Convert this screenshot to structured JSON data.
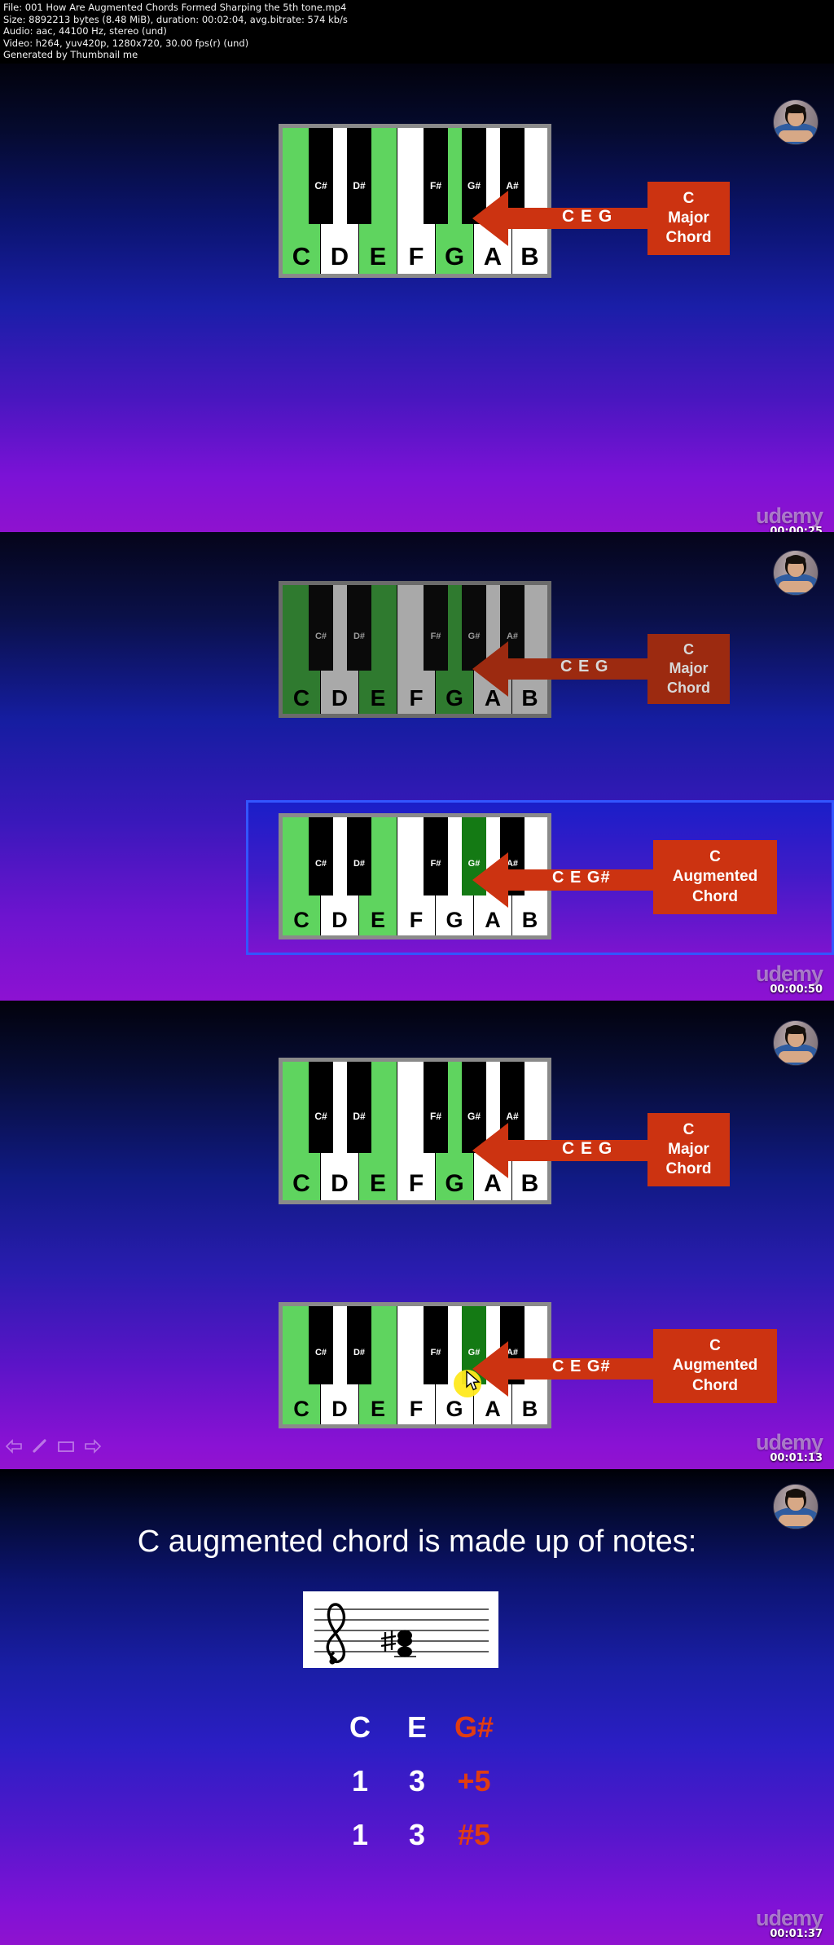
{
  "meta": {
    "lines": [
      "File: 001 How Are Augmented Chords Formed Sharping the 5th tone.mp4",
      "Size: 8892213 bytes (8.48 MiB), duration: 00:02:04, avg.bitrate: 574 kb/s",
      "Audio: aac, 44100 Hz, stereo (und)",
      "Video: h264, yuv420p, 1280x720, 30.00 fps(r) (und)",
      "Generated by Thumbnail me"
    ]
  },
  "watermark": {
    "label": "udemy"
  },
  "panels": [
    {
      "id": "panel-1",
      "timestamp": "00:00:25",
      "keyboard": {
        "white_keys": [
          {
            "label": "C",
            "highlighted": true
          },
          {
            "label": "D",
            "highlighted": false
          },
          {
            "label": "E",
            "highlighted": true
          },
          {
            "label": "F",
            "highlighted": false
          },
          {
            "label": "G",
            "highlighted": true
          },
          {
            "label": "A",
            "highlighted": false
          },
          {
            "label": "B",
            "highlighted": false
          }
        ],
        "black_keys": [
          {
            "label": "C#",
            "highlighted": false
          },
          {
            "label": "D#",
            "highlighted": false
          },
          {
            "label": "F#",
            "highlighted": false
          },
          {
            "label": "G#",
            "highlighted": false
          },
          {
            "label": "A#",
            "highlighted": false
          }
        ]
      },
      "arrow_label": "C E G",
      "chord_box": [
        "C",
        "Major",
        "Chord"
      ]
    },
    {
      "id": "panel-2a",
      "timestamp": "00:00:50",
      "keyboard": {
        "white_keys": [
          {
            "label": "C",
            "highlighted": true
          },
          {
            "label": "D",
            "highlighted": false
          },
          {
            "label": "E",
            "highlighted": true
          },
          {
            "label": "F",
            "highlighted": false
          },
          {
            "label": "G",
            "highlighted": true
          },
          {
            "label": "A",
            "highlighted": false
          },
          {
            "label": "B",
            "highlighted": false
          }
        ],
        "black_keys": [
          {
            "label": "C#",
            "highlighted": false
          },
          {
            "label": "D#",
            "highlighted": false
          },
          {
            "label": "F#",
            "highlighted": false
          },
          {
            "label": "G#",
            "highlighted": false
          },
          {
            "label": "A#",
            "highlighted": false
          }
        ]
      },
      "arrow_label": "C E G",
      "chord_box": [
        "C",
        "Major",
        "Chord"
      ]
    },
    {
      "id": "panel-2b",
      "keyboard": {
        "white_keys": [
          {
            "label": "C",
            "highlighted": true
          },
          {
            "label": "D",
            "highlighted": false
          },
          {
            "label": "E",
            "highlighted": true
          },
          {
            "label": "F",
            "highlighted": false
          },
          {
            "label": "G",
            "highlighted": false
          },
          {
            "label": "A",
            "highlighted": false
          },
          {
            "label": "B",
            "highlighted": false
          }
        ],
        "black_keys": [
          {
            "label": "C#",
            "highlighted": false
          },
          {
            "label": "D#",
            "highlighted": false
          },
          {
            "label": "F#",
            "highlighted": false
          },
          {
            "label": "G#",
            "highlighted": true
          },
          {
            "label": "A#",
            "highlighted": false
          }
        ]
      },
      "arrow_label": "C E G#",
      "chord_box": [
        "C",
        "Augmented",
        "Chord"
      ]
    },
    {
      "id": "panel-3a",
      "timestamp": "00:01:13",
      "keyboard": {
        "white_keys": [
          {
            "label": "C",
            "highlighted": true
          },
          {
            "label": "D",
            "highlighted": false
          },
          {
            "label": "E",
            "highlighted": true
          },
          {
            "label": "F",
            "highlighted": false
          },
          {
            "label": "G",
            "highlighted": true
          },
          {
            "label": "A",
            "highlighted": false
          },
          {
            "label": "B",
            "highlighted": false
          }
        ],
        "black_keys": [
          {
            "label": "C#",
            "highlighted": false
          },
          {
            "label": "D#",
            "highlighted": false
          },
          {
            "label": "F#",
            "highlighted": false
          },
          {
            "label": "G#",
            "highlighted": false
          },
          {
            "label": "A#",
            "highlighted": false
          }
        ]
      },
      "arrow_label": "C E G",
      "chord_box": [
        "C",
        "Major",
        "Chord"
      ]
    },
    {
      "id": "panel-3b",
      "keyboard": {
        "white_keys": [
          {
            "label": "C",
            "highlighted": true
          },
          {
            "label": "D",
            "highlighted": false
          },
          {
            "label": "E",
            "highlighted": true
          },
          {
            "label": "F",
            "highlighted": false
          },
          {
            "label": "G",
            "highlighted": false
          },
          {
            "label": "A",
            "highlighted": false
          },
          {
            "label": "B",
            "highlighted": false
          }
        ],
        "black_keys": [
          {
            "label": "C#",
            "highlighted": false
          },
          {
            "label": "D#",
            "highlighted": false
          },
          {
            "label": "F#",
            "highlighted": false
          },
          {
            "label": "G#",
            "highlighted": true
          },
          {
            "label": "A#",
            "highlighted": false
          }
        ]
      },
      "arrow_label": "C E G#",
      "chord_box": [
        "C",
        "Augmented",
        "Chord"
      ]
    }
  ],
  "final_slide": {
    "timestamp": "00:01:37",
    "headline": "C augmented chord is made up of notes:",
    "staff": {
      "clef": "treble",
      "accidental": "#",
      "chord_stack": "C E G#"
    },
    "rows": [
      {
        "cells": [
          {
            "text": "C",
            "accent": false
          },
          {
            "text": "E",
            "accent": false
          },
          {
            "text": "G#",
            "accent": true
          }
        ]
      },
      {
        "cells": [
          {
            "text": "1",
            "accent": false
          },
          {
            "text": "3",
            "accent": false
          },
          {
            "text": "+5",
            "accent": true
          }
        ]
      },
      {
        "cells": [
          {
            "text": "1",
            "accent": false
          },
          {
            "text": "3",
            "accent": false
          },
          {
            "text": "#5",
            "accent": true
          }
        ]
      }
    ]
  },
  "player_nav": {
    "icons": [
      "arrow-left-icon",
      "pencil-icon",
      "rectangle-icon",
      "arrow-right-icon"
    ]
  },
  "colors": {
    "accent_red": "#cc3311",
    "key_green": "#5fd45f",
    "key_dark_green": "#147a14",
    "highlight_blue": "#3355ff",
    "note_accent": "#e03c12"
  }
}
